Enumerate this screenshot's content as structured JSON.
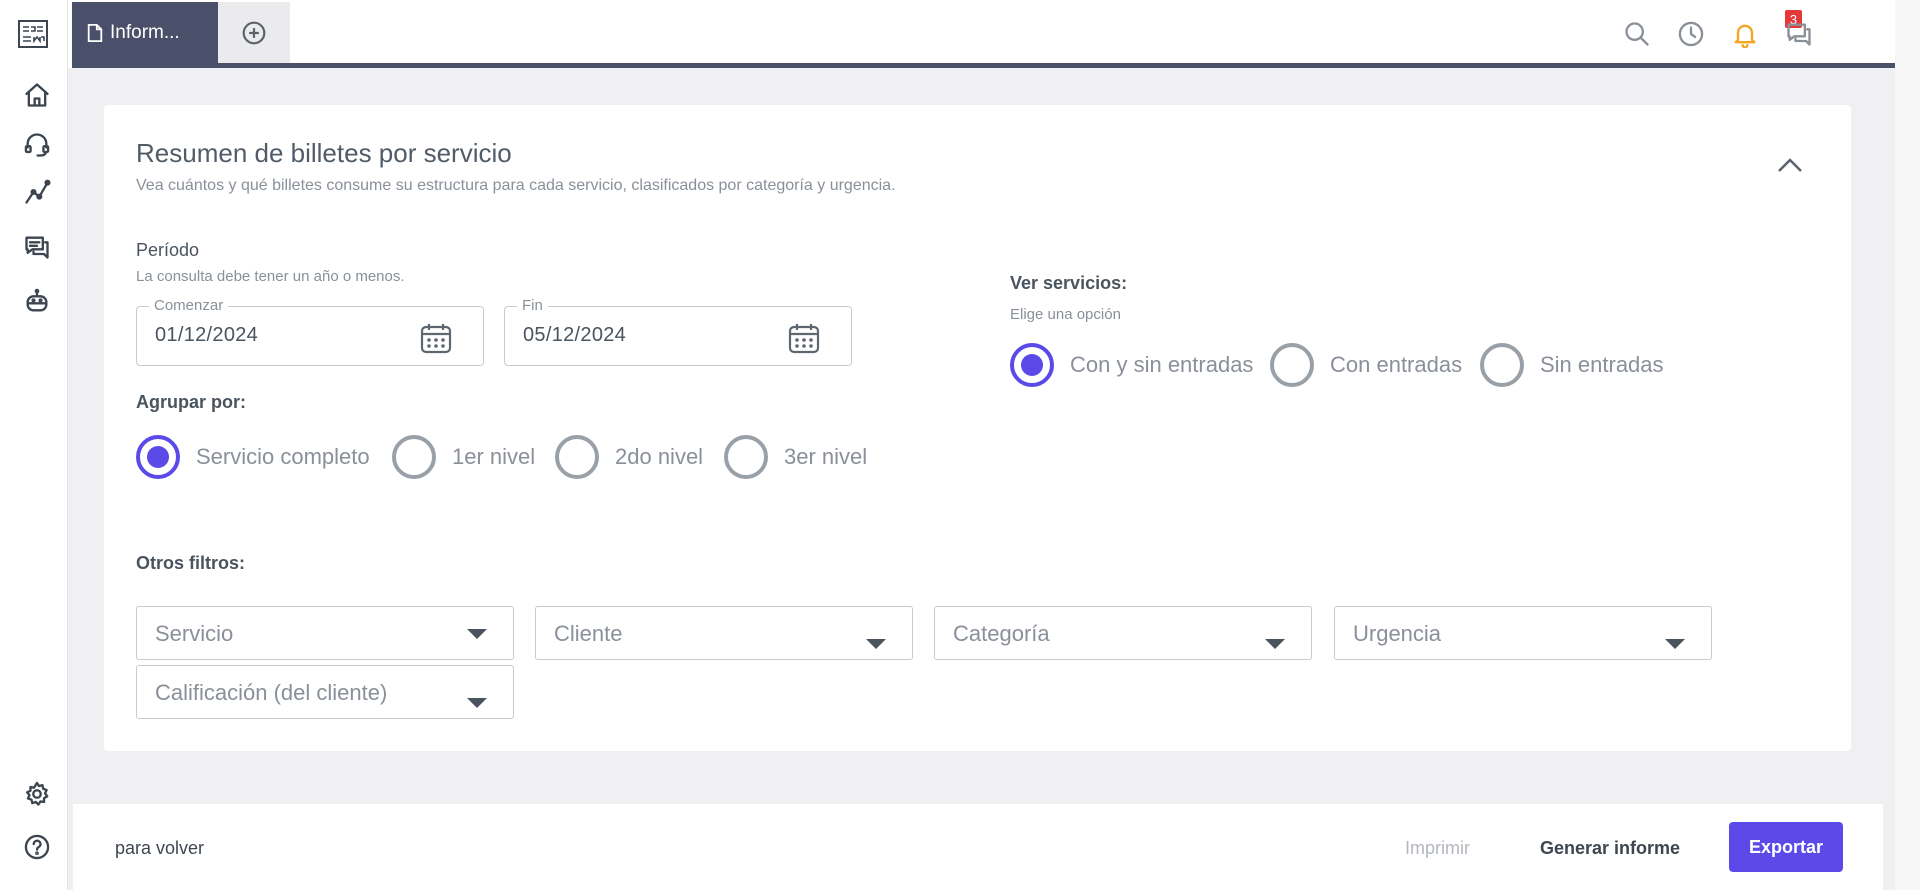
{
  "app": {
    "tab_label": "Inform...",
    "notification_count": "3"
  },
  "report": {
    "title": "Resumen de billetes por servicio",
    "subtitle": "Vea cuántos y qué billetes consume su estructura para cada servicio, clasificados por categoría y urgencia.",
    "period_label": "Período",
    "period_hint": "La consulta debe tener un año o menos.",
    "start_legend": "Comenzar",
    "start_value": "01/12/2024",
    "end_legend": "Fin",
    "end_value": "05/12/2024",
    "group_label": "Agrupar por:",
    "group_options": [
      {
        "label": "Servicio completo",
        "selected": true
      },
      {
        "label": "1er nivel",
        "selected": false
      },
      {
        "label": "2do nivel",
        "selected": false
      },
      {
        "label": "3er nivel",
        "selected": false
      }
    ],
    "view_label": "Ver servicios:",
    "view_hint": "Elige una opción",
    "view_options": [
      {
        "label": "Con y sin entradas",
        "selected": true
      },
      {
        "label": "Con entradas",
        "selected": false
      },
      {
        "label": "Sin entradas",
        "selected": false
      }
    ],
    "filters_label": "Otros filtros:",
    "filters": [
      "Servicio",
      "Cliente",
      "Categoría",
      "Urgencia",
      "Calificación (del cliente)"
    ]
  },
  "footer": {
    "back": "para volver",
    "print": "Imprimir",
    "generate": "Generar informe",
    "export": "Exportar"
  },
  "colors": {
    "accent": "#5b4ae8",
    "tab_bg": "#4b506a",
    "badge": "#e5383b",
    "bell": "#f5a623"
  },
  "icons": {
    "sidebar": [
      "home-icon",
      "headset-icon",
      "chart-line-icon",
      "chat-icon",
      "bot-icon",
      "gear-icon",
      "help-icon"
    ],
    "topbar": [
      "search-icon",
      "history-icon",
      "bell-icon",
      "chat-icon"
    ]
  }
}
